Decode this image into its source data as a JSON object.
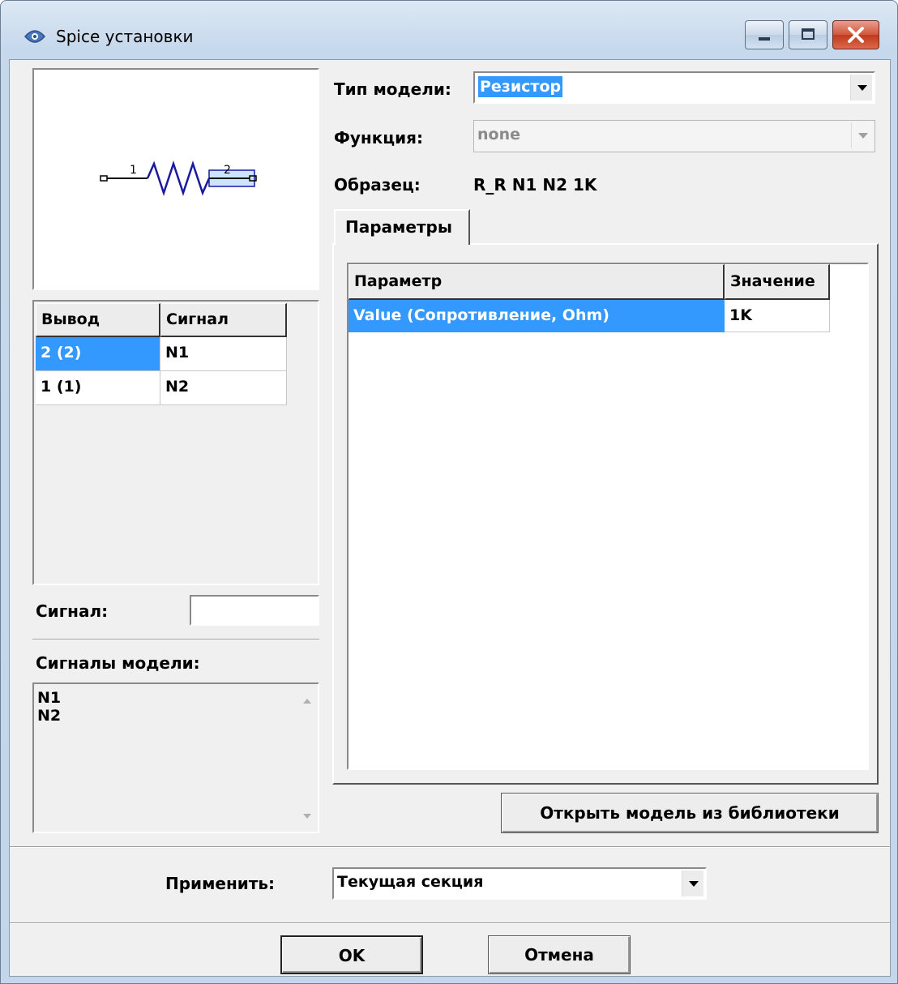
{
  "window": {
    "title": "Spice установки"
  },
  "model": {
    "type_label": "Тип модели:",
    "type_value": "Резистор",
    "function_label": "Функция:",
    "function_value": "none",
    "sample_label": "Образец:",
    "sample_value": "R_R N1 N2 1K"
  },
  "preview": {
    "pin1_label": "1",
    "pin2_label": "2"
  },
  "pins_table": {
    "headers": [
      "Вывод",
      "Сигнал"
    ],
    "rows": [
      {
        "pin": "2 (2)",
        "signal": "N1"
      },
      {
        "pin": "1 (1)",
        "signal": "N2"
      }
    ]
  },
  "signal_field": {
    "label": "Сигнал:",
    "value": ""
  },
  "model_signals": {
    "label": "Сигналы модели:",
    "items": [
      "N1",
      "N2"
    ]
  },
  "tabs": {
    "active": "Параметры"
  },
  "params_table": {
    "headers": [
      "Параметр",
      "Значение"
    ],
    "rows": [
      {
        "param": "Value (Сопротивление, Ohm)",
        "value": "1K"
      }
    ]
  },
  "buttons": {
    "open_library": "Открыть модель из библиотеки",
    "ok": "OK",
    "cancel": "Отмена"
  },
  "apply": {
    "label": "Применить:",
    "value": "Текущая секция"
  },
  "colors": {
    "selection": "#3399ff",
    "resistor": "#1a1aa0"
  }
}
